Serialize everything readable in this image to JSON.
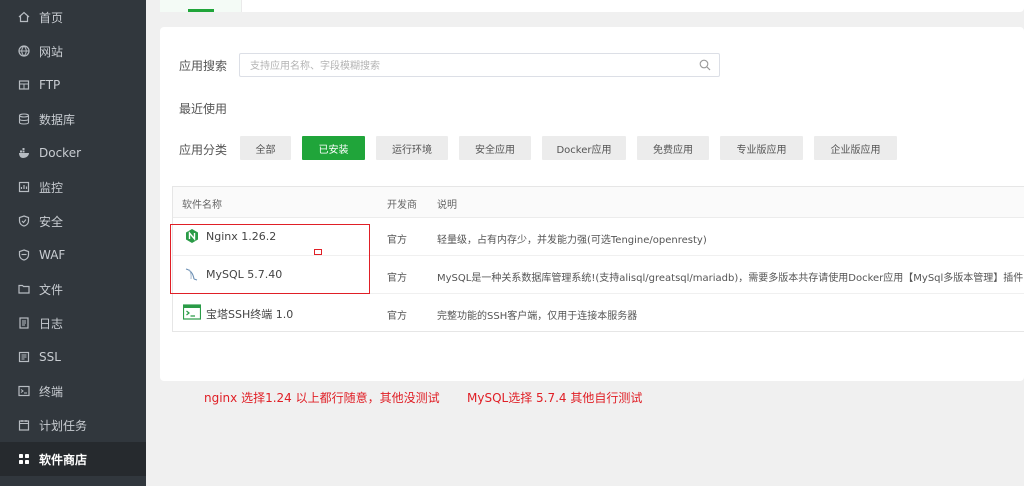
{
  "sidebar": {
    "items": [
      {
        "label": "首页",
        "icon": "home-icon"
      },
      {
        "label": "网站",
        "icon": "globe-icon"
      },
      {
        "label": "FTP",
        "icon": "ftp-icon"
      },
      {
        "label": "数据库",
        "icon": "database-icon"
      },
      {
        "label": "Docker",
        "icon": "docker-icon"
      },
      {
        "label": "监控",
        "icon": "monitor-icon"
      },
      {
        "label": "安全",
        "icon": "shield-icon"
      },
      {
        "label": "WAF",
        "icon": "waf-shield-icon"
      },
      {
        "label": "文件",
        "icon": "folder-icon"
      },
      {
        "label": "日志",
        "icon": "log-icon"
      },
      {
        "label": "SSL",
        "icon": "ssl-icon"
      },
      {
        "label": "终端",
        "icon": "terminal-icon"
      },
      {
        "label": "计划任务",
        "icon": "calendar-icon"
      },
      {
        "label": "软件商店",
        "icon": "apps-grid-icon",
        "active": true
      }
    ]
  },
  "search": {
    "label": "应用搜索",
    "placeholder": "支持应用名称、字段模糊搜索",
    "value": ""
  },
  "recent": {
    "label": "最近使用"
  },
  "categories": {
    "label": "应用分类",
    "items": [
      "全部",
      "已安装",
      "运行环境",
      "安全应用",
      "Docker应用",
      "免费应用",
      "专业版应用",
      "企业版应用"
    ],
    "selected": "已安装"
  },
  "table": {
    "headers": [
      "软件名称",
      "开发商",
      "说明"
    ],
    "rows": [
      {
        "name": "Nginx 1.26.2",
        "vendor": "官方",
        "desc": "轻量级，占有内存少，并发能力强(可选Tengine/openresty)",
        "icon": "nginx-icon"
      },
      {
        "name": "MySQL 5.7.40",
        "vendor": "官方",
        "desc": "MySQL是一种关系数据库管理系统!(支持alisql/greatsql/mariadb)，需要多版本共存请使用Docker应用【MySql多版本管理】插件",
        "icon": "mysql-icon"
      },
      {
        "name": "宝塔SSH终端 1.0",
        "vendor": "官方",
        "desc": "完整功能的SSH客户端，仅用于连接本服务器",
        "icon": "ssh-terminal-icon"
      }
    ]
  },
  "annotations": {
    "note1": "nginx 选择1.24 以上都行随意，其他没测试",
    "note2": "MySQL选择 5.7.4 其他自行测试"
  },
  "colors": {
    "accent": "#20a53a",
    "sidebar_bg": "#31373d",
    "annotation_red": "#e01f26"
  }
}
